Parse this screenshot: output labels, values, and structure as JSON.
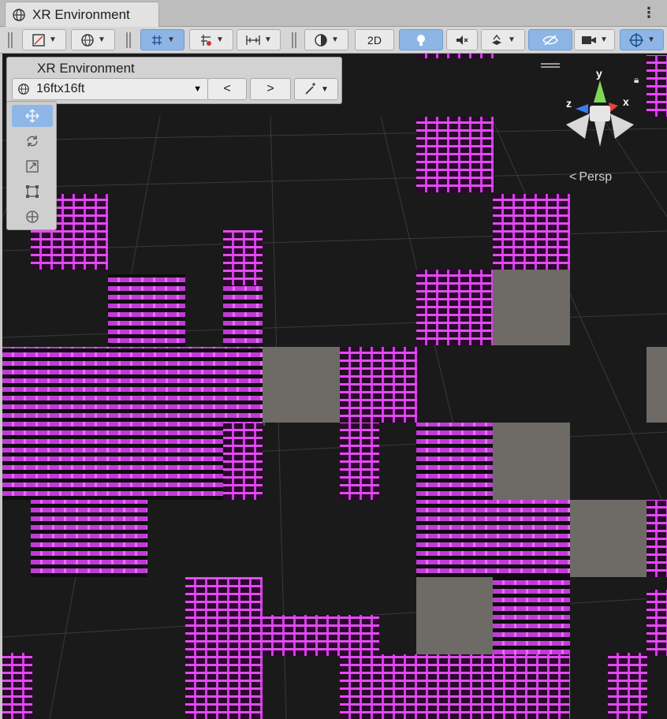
{
  "window": {
    "tab_title": "XR Environment",
    "menu_icon": "kebab-icon"
  },
  "toolbar": {
    "items": [
      {
        "name": "draw-mode-button",
        "icon": "draw-mode-icon"
      },
      {
        "name": "global-local-button",
        "icon": "globe-icon"
      },
      {
        "name": "snap-grid-button",
        "icon": "grid-snap-icon"
      },
      {
        "name": "increment-snap-button",
        "icon": "increment-snap-icon"
      },
      {
        "name": "align-button",
        "icon": "align-icon"
      },
      {
        "name": "shading-mode-button",
        "icon": "sphere-shading-icon"
      },
      {
        "name": "2d-toggle-button",
        "label": "2D"
      },
      {
        "name": "lighting-toggle-button",
        "icon": "light-bulb-icon"
      },
      {
        "name": "audio-toggle-button",
        "icon": "audio-mute-icon"
      },
      {
        "name": "effects-button",
        "icon": "effects-icon"
      },
      {
        "name": "visibility-button",
        "icon": "hidden-eye-icon"
      },
      {
        "name": "camera-button",
        "icon": "camera-icon"
      },
      {
        "name": "gizmos-button",
        "icon": "gizmo-icon"
      }
    ],
    "label_2d": "2D"
  },
  "panel": {
    "title": "XR Environment",
    "environment_value": "16ftx16ft",
    "prev_label": "<",
    "next_label": ">"
  },
  "tools": [
    "move-tool",
    "rotate-tool",
    "scale-tool",
    "rect-tool",
    "transform-tool"
  ],
  "scene": {
    "projection_label": "Persp",
    "axes": {
      "x": "x",
      "y": "y",
      "z": "z"
    },
    "colors": {
      "x_axis": "#e0443a",
      "y_axis": "#7ed957",
      "z_axis": "#3d7cf0",
      "missing_material": "#e14df0",
      "placeholder": "#6e6a66",
      "background": "#1a1a1b"
    }
  }
}
